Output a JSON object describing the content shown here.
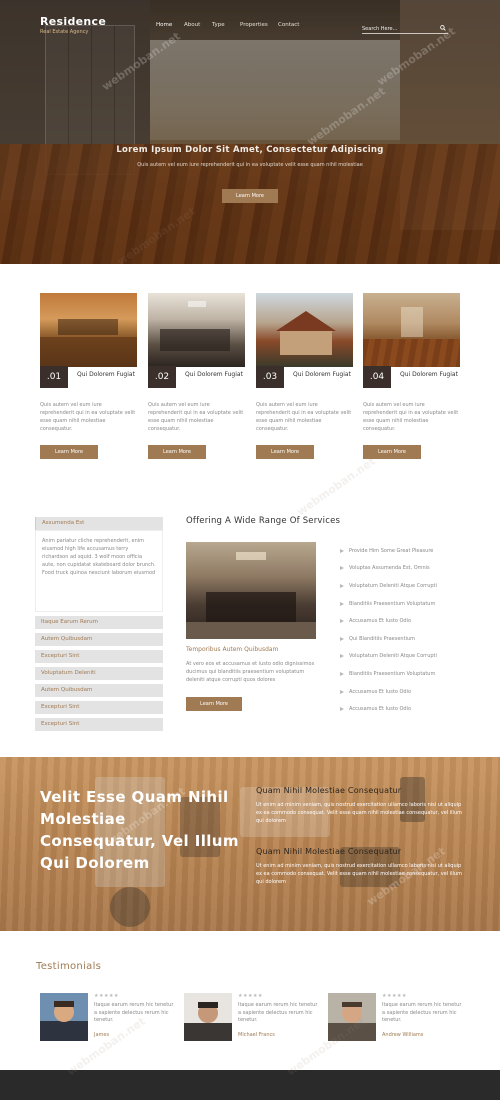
{
  "brand": {
    "title": "Residence",
    "subtitle": "Real Estate Agency"
  },
  "nav": {
    "items": [
      "Home",
      "About",
      "Type",
      "Properties",
      "Contact"
    ]
  },
  "search": {
    "placeholder": "Search Here..."
  },
  "hero": {
    "title": "Lorem Ipsum Dolor Sit Amet, Consectetur Adipiscing",
    "text": "Quis autem vel eum iure reprehenderit qui in ea voluptate velit esse quam nihil molestiae",
    "button": "Learn More"
  },
  "cards": [
    {
      "num": ".01",
      "title": "Qui Dolorem Fugiat",
      "text": "Quis autem vel eum iure reprehenderit qui in ea voluptate velit esse quam nihil molestiae consequatur.",
      "button": "Learn More"
    },
    {
      "num": ".02",
      "title": "Qui Dolorem Fugiat",
      "text": "Quis autem vel eum iure reprehenderit qui in ea voluptate velit esse quam nihil molestiae consequatur.",
      "button": "Learn More"
    },
    {
      "num": ".03",
      "title": "Qui Dolorem Fugiat",
      "text": "Quis autem vel eum iure reprehenderit qui in ea voluptate velit esse quam nihil molestiae consequatur.",
      "button": "Learn More"
    },
    {
      "num": ".04",
      "title": "Qui Dolorem Fugiat",
      "text": "Quis autem vel eum iure reprehenderit qui in ea voluptate velit esse quam nihil molestiae consequatur.",
      "button": "Learn More"
    }
  ],
  "accordion": {
    "open_title": "Assumenda Est",
    "open_text": "Anim pariatur cliche reprehenderit, enim eiusmod high life accusamus terry richardson ad squid. 3 wolf moon officia aute, non cupidatat skateboard dolor brunch. Food truck quinoa nesciunt laborum eiusmod",
    "items": [
      "Itaque Earum Rerum",
      "Autem Quibusdam",
      "Excepturi Sint",
      "Voluptatum Deleniti",
      "Autem Quibusdam",
      "Excepturi Sint",
      "Excepturi Sint"
    ]
  },
  "services": {
    "title": "Offering A Wide Range Of Services",
    "subtitle": "Temporibus Autem Quibusdam",
    "text": "At vero eos et accusamus et iusto odio dignissimos ducimus qui blanditiis praesentium voluptatum deleniti atque corrupti quos dolores",
    "button": "Learn More",
    "list": [
      "Provide Him Some Great Pleasure",
      "Voluptas Assumenda Est, Omnis",
      "Voluptatum Deleniti Atque Corrupti",
      "Blanditiis Praesentium Voluptatum",
      "Accusamus Et Iusto Odio",
      "Qui Blanditiis Praesentium",
      "Voluptatum Deleniti Atque Corrupti",
      "Blanditiis Praesentium Voluptatum",
      "Accusamus Et Iusto Odio",
      "Accusamus Et Iusto Odio"
    ]
  },
  "feature": {
    "title": "Velit Esse Quam Nihil Molestiae Consequatur, Vel Illum Qui Dolorem",
    "blocks": [
      {
        "heading": "Quam Nihil Molestiae Consequatur",
        "text": "Ut enim ad minim veniam, quis nostrud exercitation ullamco laboris nisi ut aliquip ex ea commodo consequat. Velit esse quam nihil molestiae consequatur, vel illum qui dolorem"
      },
      {
        "heading": "Quam Nihil Molestiae Consequatur",
        "text": "Ut enim ad minim veniam, quis nostrud exercitation ullamco laboris nisi ut aliquip ex ea commodo consequat. Velit esse quam nihil molestiae consequatur, vel illum qui dolorem"
      }
    ]
  },
  "testimonials": {
    "title": "Testimonials",
    "items": [
      {
        "stars": "★★★★★",
        "quote": "Itaque earum rerum hic tenetur a sapiente delectus rerum hic tenetur.",
        "name": "James"
      },
      {
        "stars": "★★★★★",
        "quote": "Itaque earum rerum hic tenetur a sapiente delectus rerum hic tenetur.",
        "name": "Michael Francs"
      },
      {
        "stars": "★★★★★",
        "quote": "Itaque earum rerum hic tenetur a sapiente delectus rerum hic tenetur.",
        "name": "Andrew Williams"
      }
    ]
  },
  "watermark": "webmoban.net",
  "colors": {
    "accent": "#a07a52",
    "dark": "#3a2f2a",
    "footer": "#2a2a2a"
  }
}
